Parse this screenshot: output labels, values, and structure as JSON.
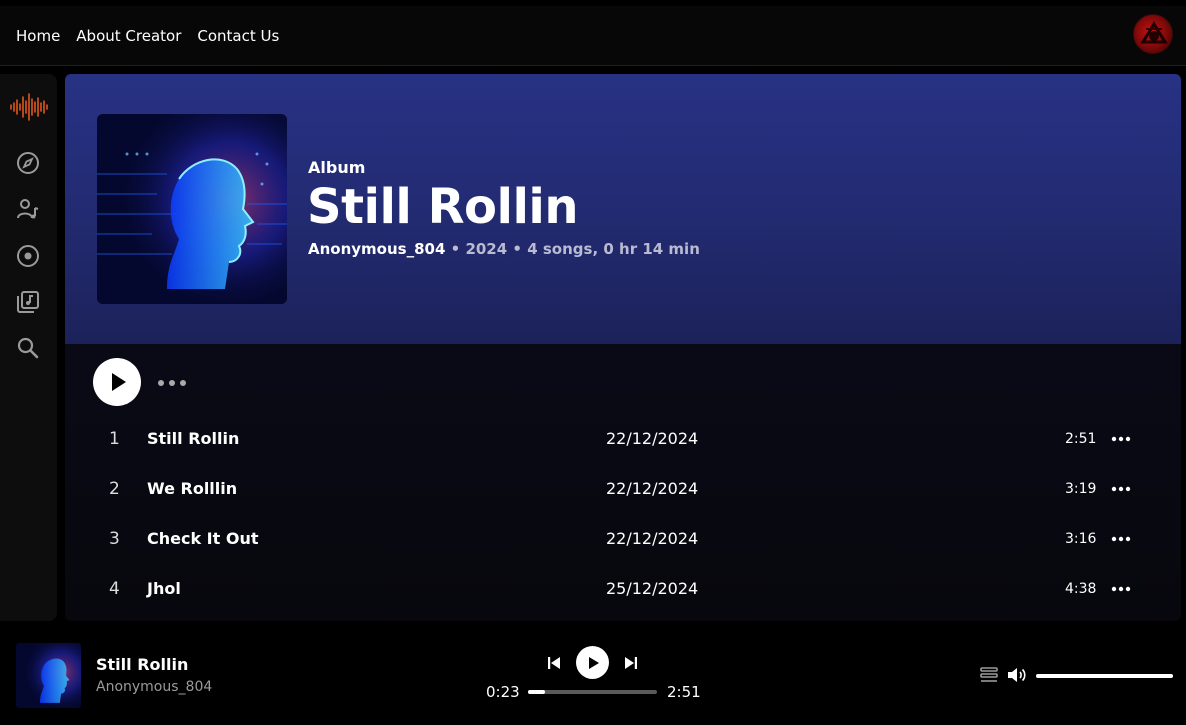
{
  "nav": {
    "links": [
      "Home",
      "About Creator",
      "Contact Us"
    ],
    "avatar_icon": "user-avatar-icon"
  },
  "sidebar": {
    "items": [
      {
        "name": "logo-waveform-icon",
        "color": "#e0581e"
      },
      {
        "name": "compass-icon"
      },
      {
        "name": "artist-icon"
      },
      {
        "name": "disc-icon"
      },
      {
        "name": "library-icon"
      },
      {
        "name": "search-icon"
      }
    ]
  },
  "album": {
    "kind": "Album",
    "title": "Still Rollin",
    "artist": "Anonymous_804",
    "details": " • 2024 • 4 songs, 0 hr 14 min"
  },
  "tracks": [
    {
      "num": "1",
      "title": "Still Rollin",
      "date": "22/12/2024",
      "duration": "2:51"
    },
    {
      "num": "2",
      "title": "We Rolllin",
      "date": "22/12/2024",
      "duration": "3:19"
    },
    {
      "num": "3",
      "title": "Check It Out",
      "date": "22/12/2024",
      "duration": "3:16"
    },
    {
      "num": "4",
      "title": "Jhol",
      "date": "25/12/2024",
      "duration": "4:38"
    }
  ],
  "player": {
    "title": "Still Rollin",
    "artist": "Anonymous_804",
    "current_time": "0:23",
    "total_time": "2:51",
    "progress": 0.13,
    "volume": 1.0
  },
  "colors": {
    "accent": "#e0581e",
    "hero": "#283284"
  }
}
